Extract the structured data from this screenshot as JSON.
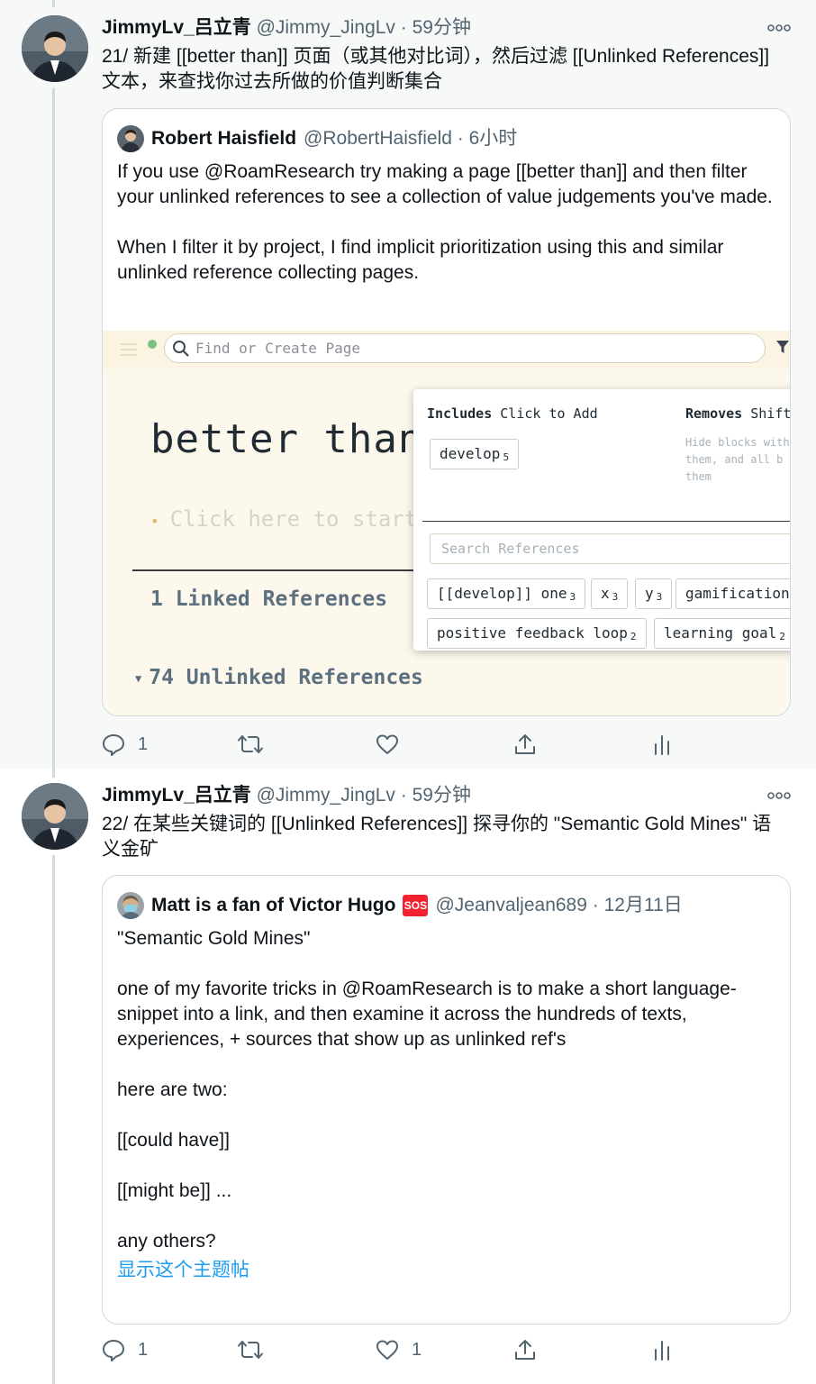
{
  "tweets": [
    {
      "author_name": "JimmyLv_吕立青",
      "handle": "@Jimmy_JingLv",
      "time": "59分钟",
      "text": "21/ 新建 [[better than]] 页面（或其他对比词），然后过滤 [[Unlinked References]] 文本，来查找你过去所做的价值判断集合",
      "quote": {
        "author_name": "Robert Haisfield",
        "handle": "@RobertHaisfield",
        "time": "6小时",
        "paragraphs": [
          "If you use @RoamResearch try making a page [[better than]] and then filter your unlinked references to see a collection of value judgements you've made.",
          "When I filter it by project, I find implicit prioritization using this and similar unlinked reference collecting pages."
        ],
        "roam": {
          "search_placeholder": "Find or Create Page",
          "page_title": "better than",
          "bullet_placeholder": "Click here to start",
          "linked_refs": "1 Linked References",
          "unlinked_refs": "74 Unlinked References",
          "popover": {
            "includes_label": "Includes",
            "includes_hint": "Click to Add",
            "removes_label": "Removes",
            "removes_hint": "Shift",
            "removes_desc": "Hide blocks with them, and all b them",
            "include_chip": {
              "label": "develop",
              "count": "5"
            },
            "search_placeholder": "Search References",
            "chips_row1": [
              {
                "label": "[[develop]] one",
                "count": "3"
              },
              {
                "label": "x",
                "count": "3"
              },
              {
                "label": "y",
                "count": "3"
              },
              {
                "label": "gamification",
                "count": ""
              }
            ],
            "chips_row2": [
              {
                "label": "positive feedback loop",
                "count": "2"
              },
              {
                "label": "learning goal",
                "count": "2"
              }
            ]
          }
        }
      },
      "actions": {
        "reply": "1",
        "retweet": "",
        "like": ""
      }
    },
    {
      "author_name": "JimmyLv_吕立青",
      "handle": "@Jimmy_JingLv",
      "time": "59分钟",
      "text": "22/ 在某些关键词的 [[Unlinked References]] 探寻你的 \"Semantic Gold Mines\" 语义金矿",
      "quote": {
        "author_name": "Matt is a fan of Victor Hugo",
        "sos_badge": "SOS",
        "handle": "@Jeanvaljean689",
        "time": "12月11日",
        "paragraphs": [
          "\"Semantic Gold Mines\"",
          "one of my favorite tricks in @RoamResearch is to make a short language-snippet into a link, and then examine it across the hundreds of texts, experiences, + sources that show up as unlinked ref's",
          "here are two:",
          "[[could have]]",
          "[[might be]] ...",
          "any others?"
        ],
        "show_thread": "显示这个主题帖"
      },
      "actions": {
        "reply": "1",
        "retweet": "",
        "like": "1"
      }
    }
  ],
  "colors": {
    "accent": "#1d9bf0",
    "muted": "#536471",
    "border": "#cfd9de",
    "sos": "#f4212e"
  },
  "icons": [
    "reply-icon",
    "retweet-icon",
    "like-icon",
    "share-icon",
    "analytics-icon",
    "more-icon",
    "search-icon",
    "filter-icon"
  ]
}
